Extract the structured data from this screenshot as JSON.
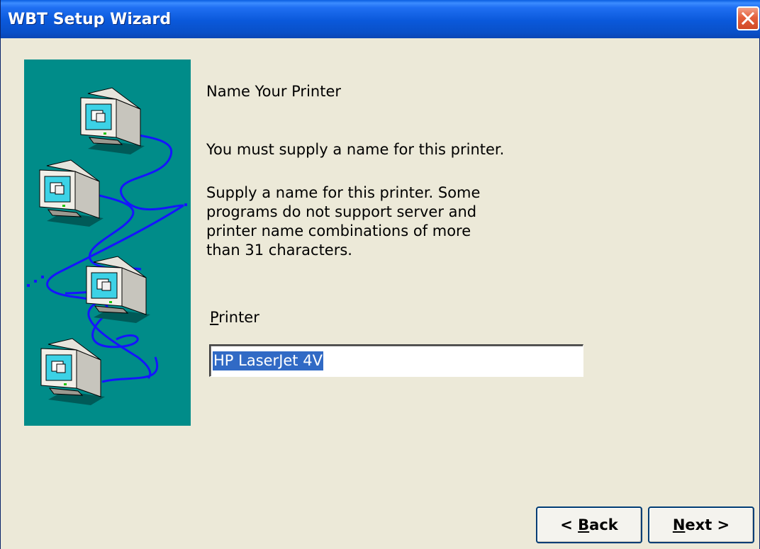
{
  "window": {
    "title": "WBT Setup Wizard"
  },
  "wizard": {
    "heading": "Name Your Printer",
    "message": "You must supply a name for this printer.",
    "description": "Supply a name for this printer. Some\nprograms do not support server and\nprinter name combinations of more\nthan 31 characters.",
    "printer_label_mnemonic": "P",
    "printer_label_rest": "rinter",
    "printer_value": "HP LaserJet 4V"
  },
  "buttons": {
    "back_prefix": "< ",
    "back_mnemonic": "B",
    "back_rest": "ack",
    "next_mnemonic": "N",
    "next_rest": "ext >"
  },
  "colors": {
    "titlebar": "#0a58da",
    "art_background": "#008c89",
    "selection": "#316ac5",
    "window_background": "#ece9d8"
  },
  "icons": [
    "close-icon",
    "network-computers-illustration"
  ]
}
